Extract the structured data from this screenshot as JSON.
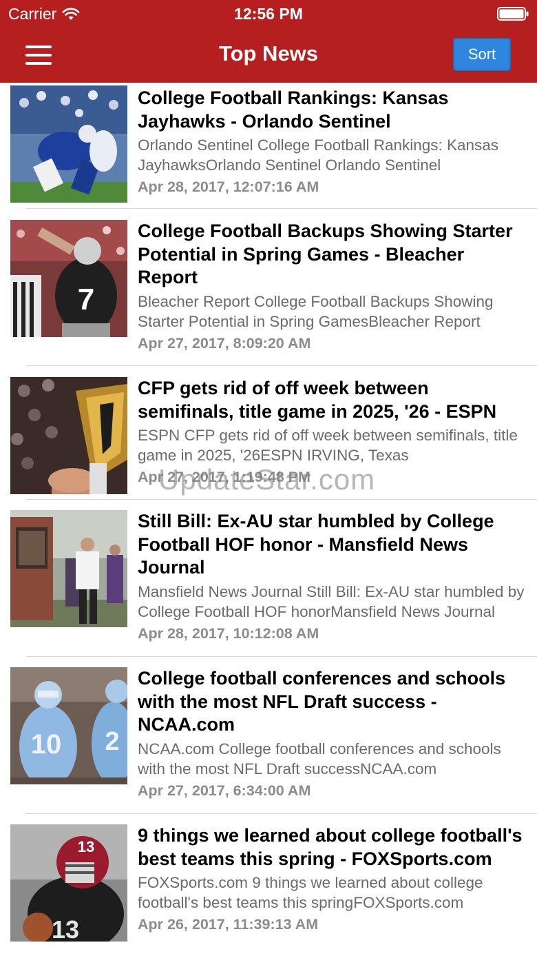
{
  "status_bar": {
    "carrier": "Carrier",
    "time": "12:56 PM",
    "wifi_icon": "wifi-icon",
    "battery_icon": "battery-icon"
  },
  "nav": {
    "menu_icon": "hamburger-menu-icon",
    "title": "Top News",
    "sort_label": "Sort"
  },
  "colors": {
    "header_bg": "#b51f1f",
    "sort_button_bg": "#2f86de",
    "title_text": "#000000",
    "snippet_text": "#6b6b6b",
    "date_text": "#8c8c8c"
  },
  "articles": [
    {
      "title": "College Football Rankings: Kansas Jayhawks - Orlando Sentinel",
      "snippet": "Orlando Sentinel    College Football Rankings: Kansas JayhawksOrlando Sentinel  Orlando Sentinel",
      "date": "Apr 28, 2017, 12:07:16 AM"
    },
    {
      "title": "College Football Backups Showing Starter Potential in Spring Games - Bleacher Report",
      "snippet": "Bleacher Report    College Football Backups Showing Starter Potential in Spring GamesBleacher Report",
      "date": "Apr 27, 2017, 8:09:20 AM"
    },
    {
      "title": "CFP gets rid of off week between semifinals, title game in 2025, '26 - ESPN",
      "snippet": "ESPN    CFP gets rid of off week between semifinals, title game in 2025, '26ESPN  IRVING, Texas",
      "date": "Apr 27, 2017, 1:19:48 PM"
    },
    {
      "title": "Still Bill: Ex-AU star humbled by College Football HOF honor - Mansfield News Journal",
      "snippet": "Mansfield News Journal    Still Bill: Ex-AU star humbled by College Football HOF honorMansfield News Journal",
      "date": "Apr 28, 2017, 10:12:08 AM"
    },
    {
      "title": "College football conferences and schools with the most NFL Draft success - NCAA.com",
      "snippet": "NCAA.com    College football conferences and schools with the most NFL Draft successNCAA.com",
      "date": "Apr 27, 2017, 6:34:00 AM"
    },
    {
      "title": "9 things we learned about college football's best teams this spring - FOXSports.com",
      "snippet": "FOXSports.com    9 things we learned about college football's best teams this springFOXSports.com",
      "date": "Apr 26, 2017, 11:39:13 AM"
    }
  ],
  "watermark": "UpdateStar.com"
}
